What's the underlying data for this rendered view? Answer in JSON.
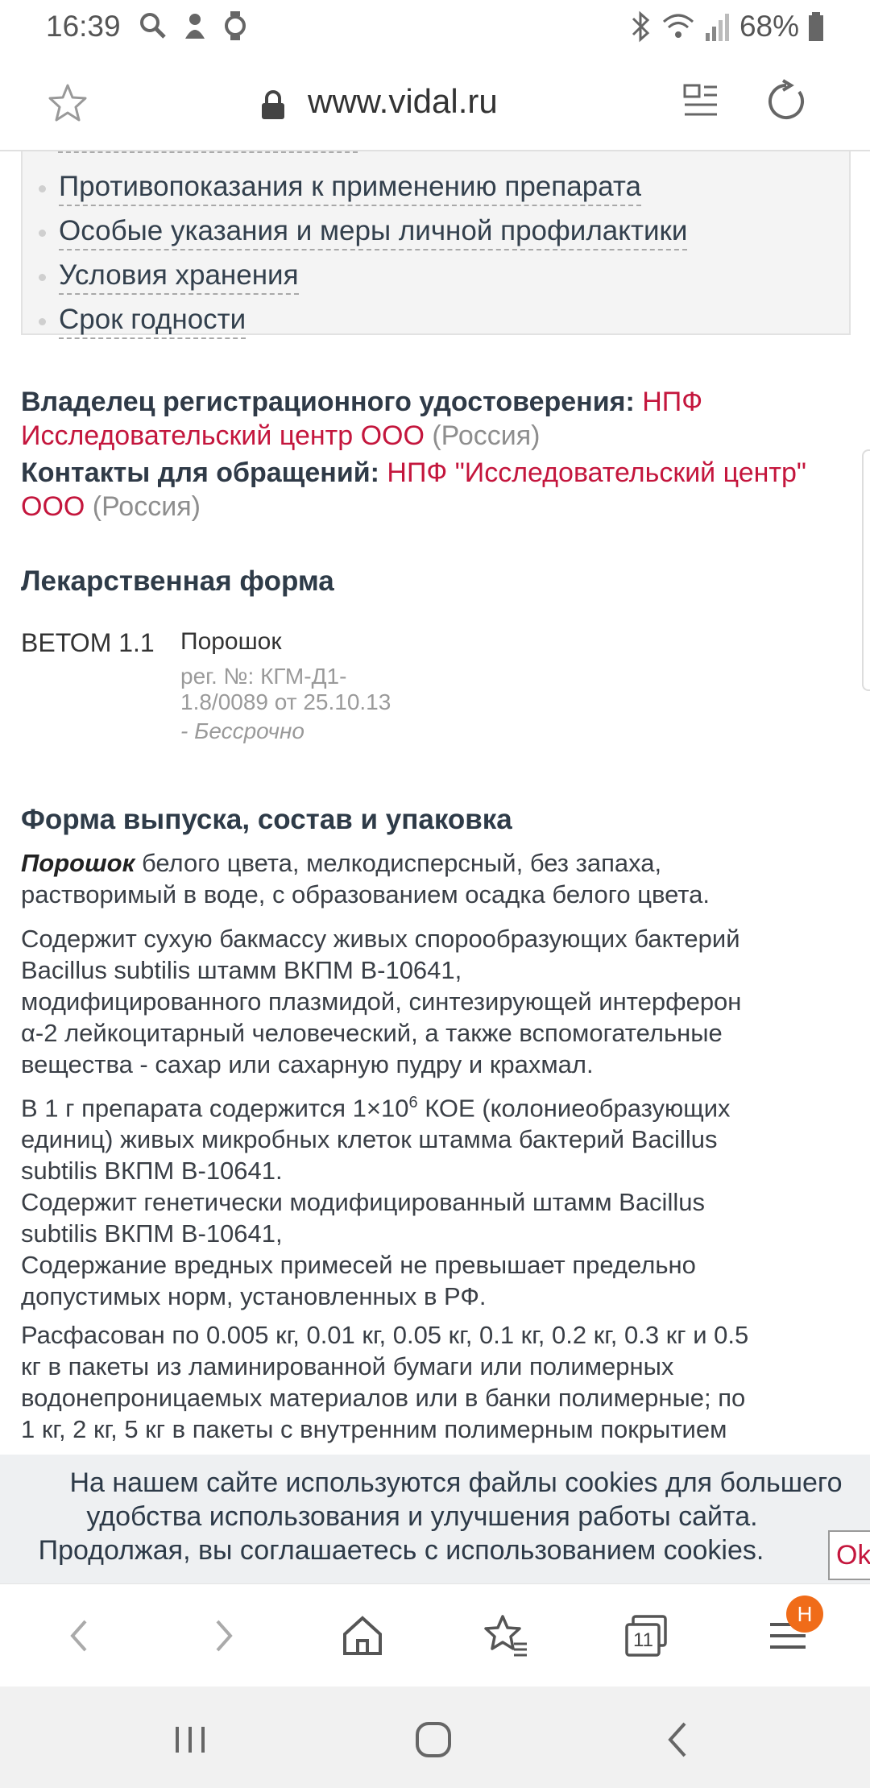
{
  "status": {
    "time": "16:39",
    "battery": "68%"
  },
  "address": {
    "url": "www.vidal.ru"
  },
  "toc": {
    "items": [
      "Противопоказания к применению препарата",
      "Особые указания и меры личной профилактики",
      "Условия хранения",
      "Срок годности"
    ]
  },
  "owner": {
    "label": "Владелец регистрационного удостоверения:",
    "name": "НПФ Исследовательский центр ООО",
    "country": "(Россия)"
  },
  "contacts": {
    "label": "Контакты для обращений:",
    "name": "НПФ \"Исследовательский центр\" ООО",
    "country": "(Россия)"
  },
  "dosage": {
    "heading": "Лекарственная форма",
    "product": "ВЕТОМ 1.1",
    "form": "Порошок",
    "reg_line1": "рег. №: КГМ-Д1-",
    "reg_line2": "1.8/0089 от 25.10.13",
    "term": "- Бессрочно"
  },
  "release": {
    "heading": "Форма выпуска, состав и упаковка",
    "p1_bold": "Порошок",
    "p1_line1": " белого цвета, мелкодисперсный, без запаха,",
    "p1_line2": "растворимый в воде, с образованием осадка белого цвета.",
    "p2_lines": [
      "Содержит сухую бакмассу живых спорообразующих бактерий",
      "Bacillus subtilis штамм ВКПМ В-10641,",
      "модифицированного плазмидой, синтезирующей интерферон",
      "α-2 лейкоцитарный человеческий, а также вспомогательные",
      "вещества - сахар или сахарную пудру и крахмал."
    ],
    "p3_line1_pre": "В 1 г препарата содержится 1×10",
    "p3_line1_sup": "6",
    "p3_line1_post": " КОЕ (колониеобразующих",
    "p3_lines": [
      "единиц) живых микробных клеток штамма бактерий Bacillus",
      "subtilis ВКПМ В-10641.",
      "Содержит генетически модифицированный штамм Bacillus",
      "subtilis ВКПМ В-10641,",
      "Содержание вредных примесей не превышает предельно",
      "допустимых норм, установленных в РФ."
    ],
    "p4_lines": [
      "Расфасован по 0.005 кг, 0.01 кг, 0.05 кг, 0.1 кг, 0.2 кг, 0.3 кг и 0.5",
      "кг в пакеты из ламинированной бумаги или полимерных",
      "водонепроницаемых материалов или в банки полимерные; по",
      "1 кг, 2 кг, 5 кг в пакеты с внутренним полимерным покрытием"
    ]
  },
  "cookie": {
    "line1": "На нашем сайте используются файлы cookies для большего",
    "line2": "удобства использования и улучшения работы сайта.",
    "line3": "Продолжая, вы соглашаетесь с использованием cookies.",
    "ok": "Ok"
  },
  "toolbar": {
    "tabs_count": "11",
    "menu_badge": "H"
  }
}
